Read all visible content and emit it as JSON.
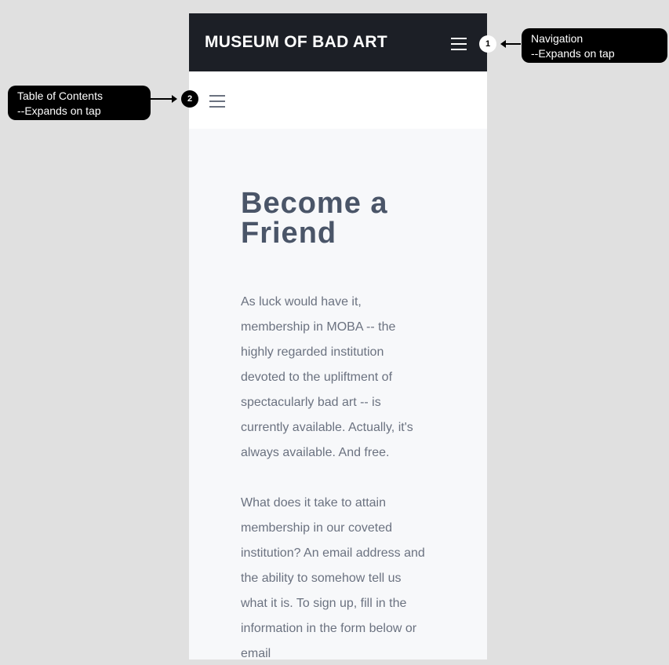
{
  "header": {
    "brand": "MUSEUM OF BAD ART"
  },
  "main": {
    "title": "Become a Friend",
    "paragraphs": [
      [
        "As luck would have it,",
        "membership in MOBA -- the",
        "highly regarded institution",
        "devoted to the upliftment of",
        "spectacularly bad art -- is",
        "currently available. Actually, it's",
        "always available. And free."
      ],
      [
        "What does it take to attain",
        "membership in our coveted",
        "institution? An email address and",
        "the ability to somehow tell us",
        "what it is. To sign up, fill in the",
        "information in the form below or",
        "email"
      ]
    ]
  },
  "annotations": [
    {
      "number": "1",
      "title": "Navigation",
      "note": "--Expands on tap"
    },
    {
      "number": "2",
      "title": "Table of Contents",
      "note": "--Expands on tap"
    }
  ]
}
